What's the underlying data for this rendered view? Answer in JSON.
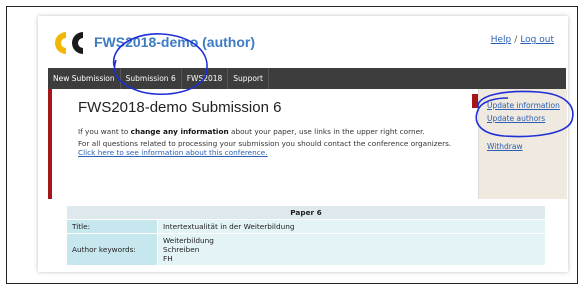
{
  "header": {
    "app_title": "FWS2018-demo (author)",
    "help_label": "Help",
    "separator": "/",
    "logout_label": "Log out"
  },
  "nav": {
    "items": [
      {
        "label": "New Submission"
      },
      {
        "label": "Submission 6"
      },
      {
        "label": "FWS2018"
      },
      {
        "label": "Support"
      }
    ]
  },
  "main": {
    "title": "FWS2018-demo Submission 6",
    "info_p1_prefix": "If you want to ",
    "info_p1_bold": "change any information",
    "info_p1_suffix": " about your paper, use links in the upper right corner.",
    "info_p2_prefix": "For all questions related to processing your submission you should contact the conference organizers. ",
    "info_p2_link": "Click here to see information about this conference."
  },
  "side_panel": {
    "links": [
      {
        "label": "Update information"
      },
      {
        "label": "Update authors"
      },
      {
        "label": "Withdraw"
      }
    ]
  },
  "paper": {
    "heading": "Paper 6",
    "title_label": "Title:",
    "title_value": "Intertextualität in der Weiterbildung",
    "keywords_label": "Author keywords:",
    "keywords": [
      "Weiterbildung",
      "Schreiben",
      "FH"
    ]
  },
  "colors": {
    "accent_red": "#a3171b",
    "link_blue": "#2b5fb3",
    "nav_bg": "#3d3d3d",
    "annotation_blue": "#1f2fd6"
  }
}
